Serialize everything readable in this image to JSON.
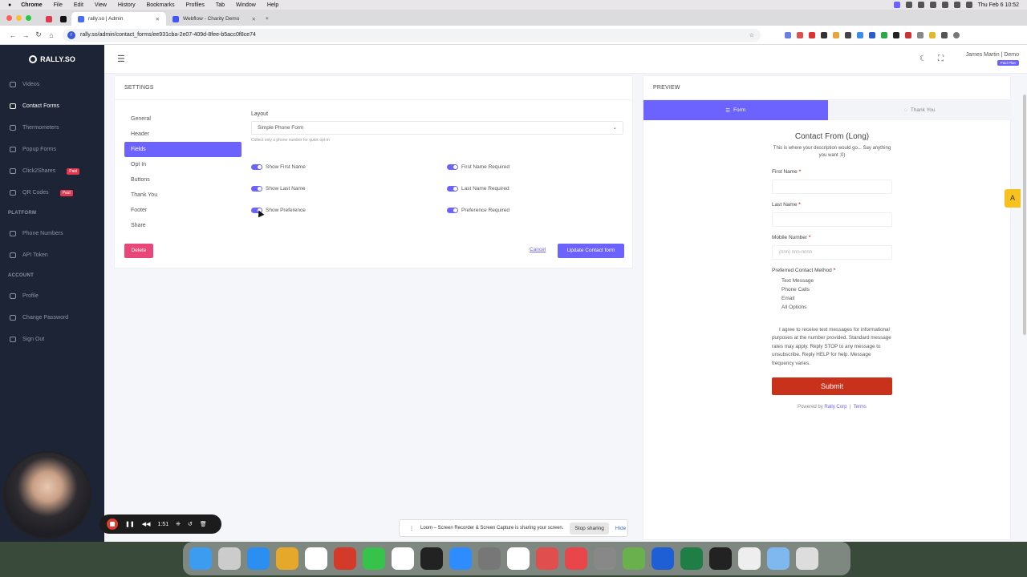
{
  "macos": {
    "menu": [
      "Chrome",
      "File",
      "Edit",
      "View",
      "History",
      "Bookmarks",
      "Profiles",
      "Tab",
      "Window",
      "Help"
    ],
    "clock": "Thu Feb 6  10:52"
  },
  "browser": {
    "tabs": [
      {
        "title": "rally.so | Admin"
      },
      {
        "title": "Webflow - Charity Demo"
      }
    ],
    "url": "rally.so/admin/contact_forms/ee931cba-2e07-409d-8fee-b5acc0f8ce74"
  },
  "sidebar": {
    "logo": "RALLY.SO",
    "items": [
      {
        "label": "Videos"
      },
      {
        "label": "Contact Forms"
      },
      {
        "label": "Thermometers"
      },
      {
        "label": "Popup Forms"
      },
      {
        "label": "Click2Shares",
        "badge": "Paid"
      },
      {
        "label": "QR Codes",
        "badge": "Paid"
      }
    ],
    "platform_label": "PLATFORM",
    "platform_items": [
      {
        "label": "Phone Numbers"
      },
      {
        "label": "API Token"
      }
    ],
    "account_label": "ACCOUNT",
    "account_items": [
      {
        "label": "Profile"
      },
      {
        "label": "Change Password"
      },
      {
        "label": "Sign Out"
      }
    ]
  },
  "header": {
    "user_name": "James Martin | Demo",
    "user_badge": "Paid Plan"
  },
  "settings": {
    "title": "SETTINGS",
    "nav": [
      "General",
      "Header",
      "Fields",
      "Opt In",
      "Buttons",
      "Thank You",
      "Footer",
      "Share"
    ],
    "active_nav": "Fields",
    "layout_label": "Layout",
    "layout_value": "Simple Phone Form",
    "layout_hint": "Collect only a phone number for quick opt-in",
    "toggles": [
      {
        "label": "Show First Name",
        "on": true
      },
      {
        "label": "First Name Required",
        "on": true
      },
      {
        "label": "Show Last Name",
        "on": true
      },
      {
        "label": "Last Name Required",
        "on": true
      },
      {
        "label": "Show Preference",
        "on": true
      },
      {
        "label": "Preference Required",
        "on": true
      }
    ],
    "delete_label": "Delete",
    "cancel_label": "Cancel",
    "update_label": "Update Contact form"
  },
  "preview": {
    "title": "PREVIEW",
    "tab_form": "Form",
    "tab_thankyou": "Thank You",
    "form_title": "Contact From (Long)",
    "form_desc": "This is where your description would go... Say anything you want ;0)",
    "first_name": "First Name",
    "last_name": "Last Name",
    "mobile": "Mobile Number",
    "mobile_placeholder": "(nnn) nnn-nnnn",
    "pref_label": "Preferred Contact Method",
    "required_mark": "*",
    "options": [
      "Text Message",
      "Phone Calls",
      "Email",
      "All Options"
    ],
    "agree": "I agree to receive text messages for informational purposes at the number provided. Standard message rates may apply. Reply STOP to any message to unsubscribe. Reply HELP for help. Message frequency varies.",
    "submit": "Submit",
    "powered_prefix": "Powered by",
    "powered_link": "Rally Corp",
    "powered_sep": "|",
    "terms": "Terms"
  },
  "recorder": {
    "time": "1:51"
  },
  "loom": {
    "message": "Loom – Screen Recorder & Screen Capture is sharing your screen.",
    "stop": "Stop sharing",
    "hide": "Hide"
  },
  "colors": {
    "accent": "#6c63ff",
    "danger": "#e9477a",
    "submit": "#c8321a",
    "sidebar": "#1d2435"
  }
}
